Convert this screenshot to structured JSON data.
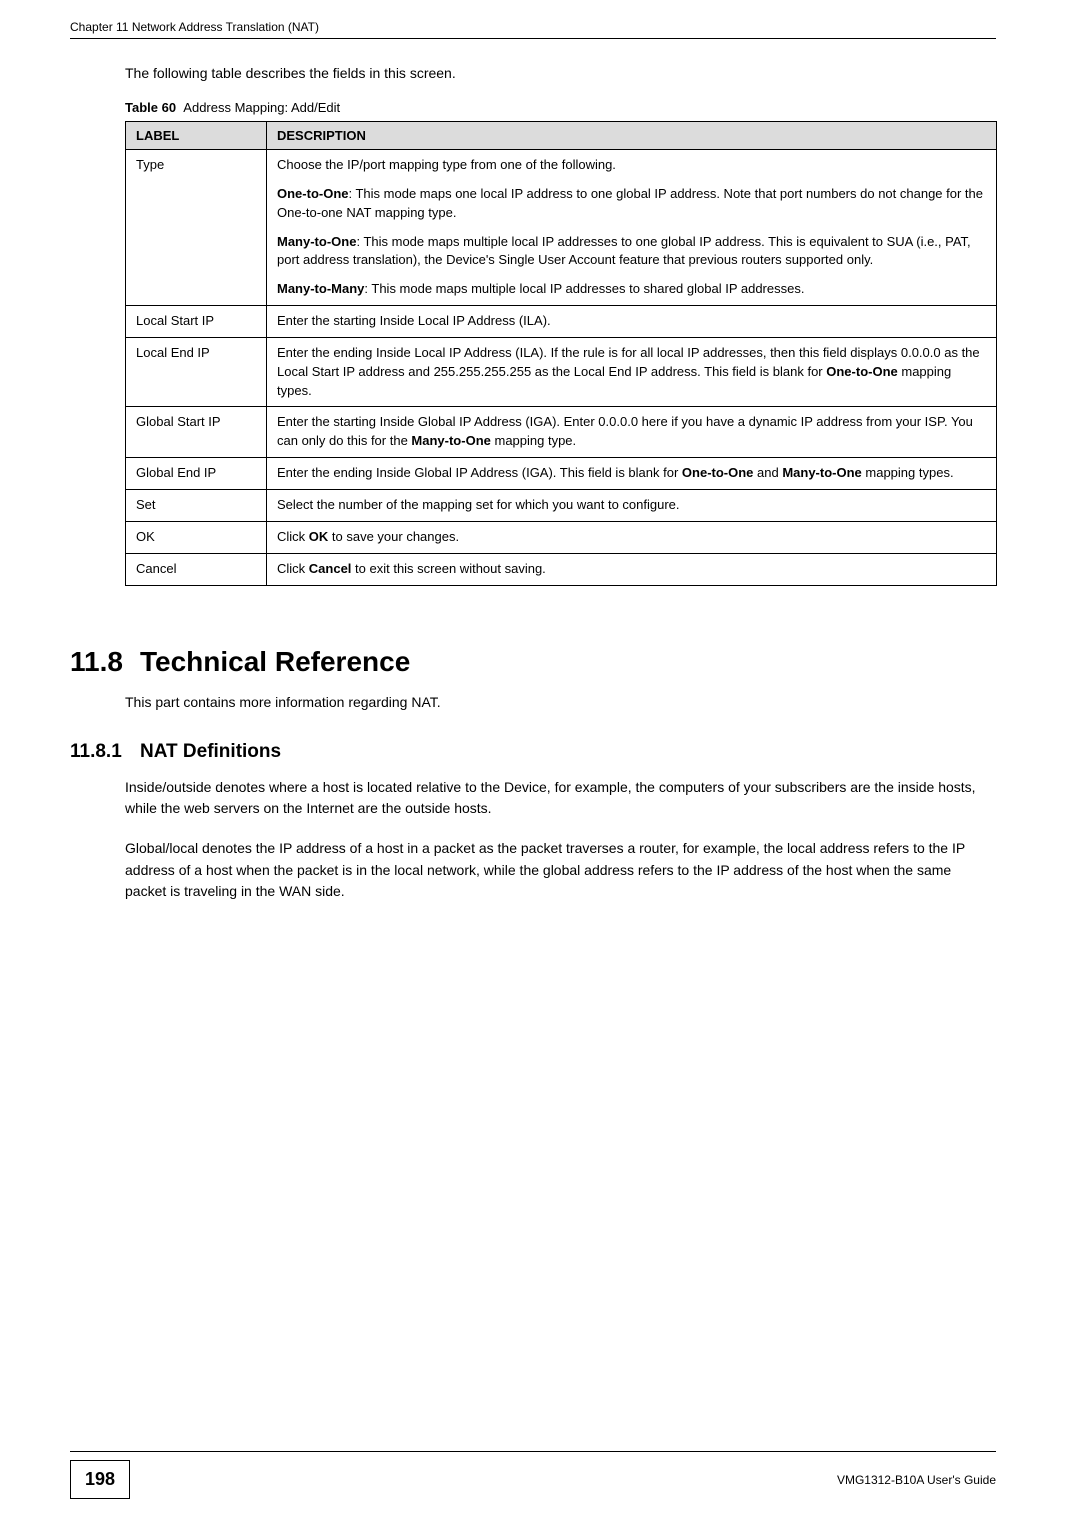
{
  "header": {
    "chapter": "Chapter 11 Network Address Translation (NAT)"
  },
  "intro": "The following table describes the fields in this screen.",
  "table": {
    "caption_prefix": "Table 60",
    "caption_title": "Address Mapping: Add/Edit",
    "headers": {
      "label": "LABEL",
      "description": "DESCRIPTION"
    },
    "rows": [
      {
        "label": "Type",
        "desc_lines": [
          "Choose the IP/port mapping type from one of the following.",
          "__B__One-to-One__B__: This mode maps one local IP address to one global IP address. Note that port numbers do not change for the One-to-one NAT mapping type.",
          "__B__Many-to-One__B__: This mode maps multiple local IP addresses to one global IP address. This is equivalent to SUA (i.e., PAT, port address translation), the Device's Single User Account feature that previous routers supported only.",
          "__B__Many-to-Many__B__: This mode maps multiple local IP addresses to shared global IP addresses."
        ]
      },
      {
        "label": "Local Start IP",
        "desc_lines": [
          "Enter the starting Inside Local IP Address (ILA)."
        ]
      },
      {
        "label": "Local End IP",
        "desc_lines": [
          "Enter the ending Inside Local IP Address (ILA). If the rule is for all local IP addresses, then this field displays 0.0.0.0 as the Local Start IP address and 255.255.255.255 as the Local End IP address. This field is blank for __B__One-to-One__B__ mapping types."
        ]
      },
      {
        "label": "Global Start IP",
        "desc_lines": [
          "Enter the starting Inside Global IP Address (IGA). Enter 0.0.0.0 here if you have a dynamic IP address from your ISP. You can only do this for the __B__Many-to-One__B__ mapping type."
        ]
      },
      {
        "label": "Global End IP",
        "desc_lines": [
          "Enter the ending Inside Global IP Address (IGA). This field is blank for __B__One-to-One__B__ and __B__Many-to-One__B__ mapping types."
        ]
      },
      {
        "label": "Set",
        "desc_lines": [
          "Select the number of the mapping set for which you want to configure."
        ]
      },
      {
        "label": "OK",
        "desc_lines": [
          "Click __B__OK__B__ to save your changes."
        ]
      },
      {
        "label": "Cancel",
        "desc_lines": [
          "Click __B__Cancel__B__ to exit this screen without saving."
        ]
      }
    ]
  },
  "section": {
    "number": "11.8",
    "title": "Technical Reference",
    "intro": "This part contains more information regarding NAT."
  },
  "subsection": {
    "number": "11.8.1",
    "title": "NAT Definitions",
    "paras": [
      "Inside/outside denotes where a host is located relative to the Device, for example, the computers of your subscribers are the inside hosts, while the web servers on the Internet are the outside hosts.",
      "Global/local denotes the IP address of a host in a packet as the packet traverses a router, for example, the local address refers to the IP address of a host when the packet is in the local network, while the global address refers to the IP address of the host when the same packet is traveling in the WAN side."
    ]
  },
  "footer": {
    "page": "198",
    "guide": "VMG1312-B10A User's Guide"
  }
}
